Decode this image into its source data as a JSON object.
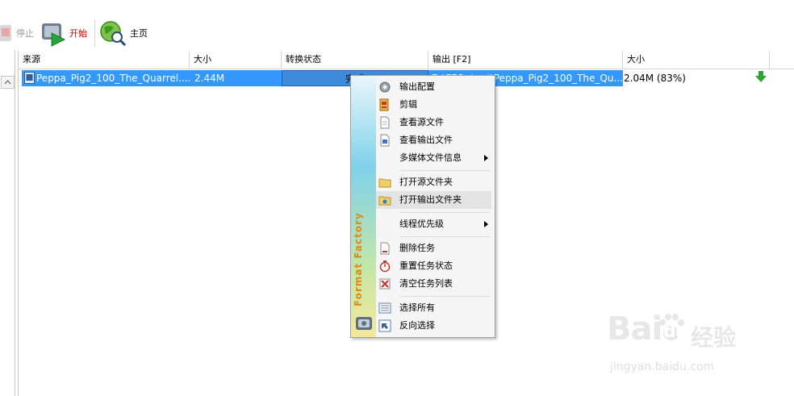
{
  "toolbar": {
    "stop_label": "停止",
    "start_label": "开始",
    "home_label": "主页"
  },
  "columns": [
    "来源",
    "大小",
    "转换状态",
    "输出 [F2]",
    "大小"
  ],
  "row": {
    "source": "Peppa_Pig2_100_The_Quarrel....",
    "size": "2.44M",
    "status": "完成",
    "output": "D:\\FFOutput\\Peppa_Pig2_100_The_Qu...",
    "output_size": "2.04M  (83%)"
  },
  "menu": {
    "items": [
      {
        "label": "输出配置",
        "icon": "gear-icon"
      },
      {
        "label": "剪辑",
        "icon": "clip-icon"
      },
      {
        "label": "查看源文件",
        "icon": "document-icon"
      },
      {
        "label": "查看输出文件",
        "icon": "document-output-icon"
      },
      {
        "label": "多媒体文件信息",
        "icon": "",
        "submenu": true
      },
      {
        "label": "打开源文件夹",
        "icon": "folder-icon"
      },
      {
        "label": "打开输出文件夹",
        "icon": "folder-open-icon",
        "highlighted": true
      },
      {
        "label": "线程优先级",
        "icon": "",
        "submenu": true
      },
      {
        "label": "删除任务",
        "icon": "delete-task-icon"
      },
      {
        "label": "重置任务状态",
        "icon": "reset-icon"
      },
      {
        "label": "清空任务列表",
        "icon": "clear-list-icon"
      },
      {
        "label": "选择所有",
        "icon": "select-all-icon"
      },
      {
        "label": "反向选择",
        "icon": "invert-select-icon"
      }
    ],
    "brand": "Format Factory"
  },
  "watermark": {
    "brand": "Bai",
    "brand2": "du",
    "jingyan": "经验",
    "url": "jingyan.baidu.com"
  },
  "colors": {
    "selection": "#3399ff",
    "menu_bg": "#f5f5f5",
    "brand_text": "#e38a13",
    "start_text": "#cc0000"
  }
}
